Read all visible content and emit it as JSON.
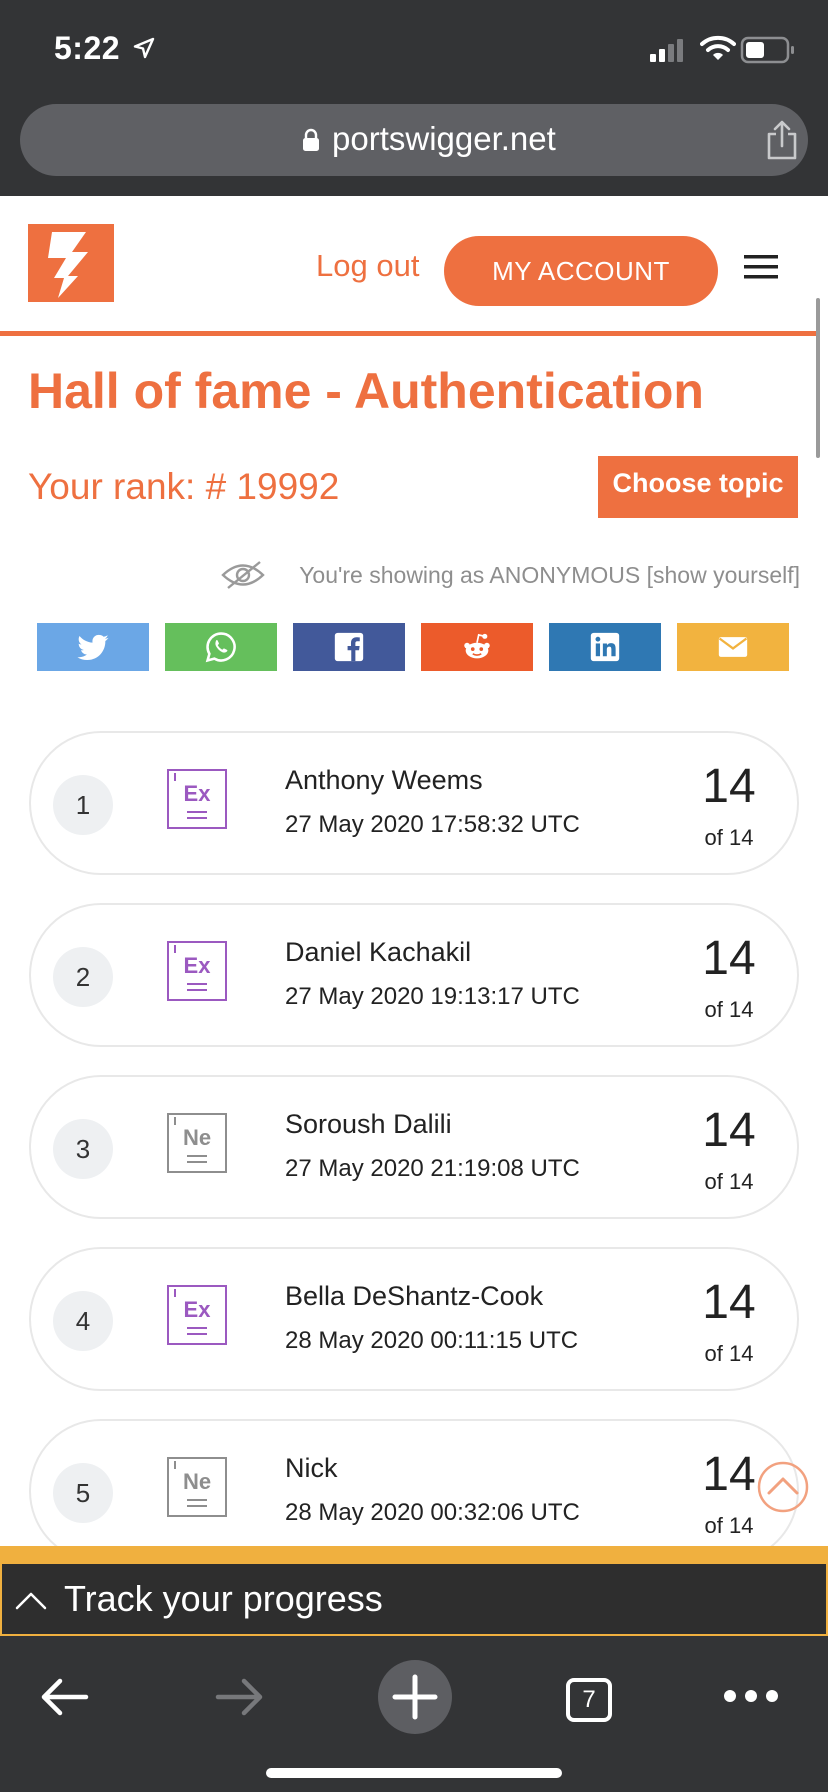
{
  "status_bar": {
    "time": "5:22"
  },
  "browser": {
    "url": "portswigger.net",
    "tab_count": "7"
  },
  "header": {
    "logout_label": "Log out",
    "account_label": "MY ACCOUNT"
  },
  "page": {
    "title": "Hall of fame - Authentication",
    "rank_text": "Your rank: # 19992",
    "choose_topic_label": "Choose topic",
    "anonymous_text": "You're showing as ANONYMOUS [show yourself]"
  },
  "share": {
    "buttons": [
      {
        "icon": "twitter-icon",
        "color": "#6ba7e6"
      },
      {
        "icon": "whatsapp-icon",
        "color": "#65bf5c"
      },
      {
        "icon": "facebook-icon",
        "color": "#42599a"
      },
      {
        "icon": "reddit-icon",
        "color": "#ec5b2b"
      },
      {
        "icon": "linkedin-icon",
        "color": "#2f78b3"
      },
      {
        "icon": "email-icon",
        "color": "#f2b33f"
      }
    ]
  },
  "leaderboard": {
    "entries": [
      {
        "rank": "1",
        "level": "Ex",
        "name": "Anthony Weems",
        "date": "27 May 2020 17:58:32 UTC",
        "score": "14",
        "of": "of 14"
      },
      {
        "rank": "2",
        "level": "Ex",
        "name": "Daniel Kachakil",
        "date": "27 May 2020 19:13:17 UTC",
        "score": "14",
        "of": "of 14"
      },
      {
        "rank": "3",
        "level": "Ne",
        "name": "Soroush Dalili",
        "date": "27 May 2020 21:19:08 UTC",
        "score": "14",
        "of": "of 14"
      },
      {
        "rank": "4",
        "level": "Ex",
        "name": "Bella DeShantz-Cook",
        "date": "28 May 2020 00:11:15 UTC",
        "score": "14",
        "of": "of 14"
      },
      {
        "rank": "5",
        "level": "Ne",
        "name": "Nick",
        "date": "28 May 2020 00:32:06 UTC",
        "score": "14",
        "of": "of 14"
      }
    ]
  },
  "track": {
    "label": "Track your progress"
  },
  "colors": {
    "brand": "#ee7040",
    "expert": "#9b59c0",
    "neutral": "#8e8e8e",
    "track": "#f0b03f"
  }
}
